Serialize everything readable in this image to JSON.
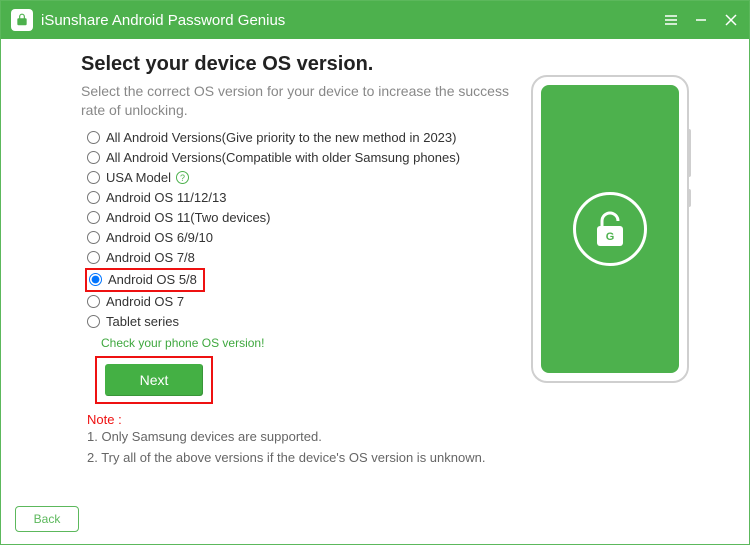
{
  "app": {
    "title": "iSunshare Android Password Genius"
  },
  "page": {
    "heading": "Select your device OS version.",
    "subheading": "Select the correct OS version for your device to increase the success rate of unlocking."
  },
  "options": [
    {
      "label": "All Android Versions(Give priority to the new method in 2023)",
      "selected": false,
      "help": false
    },
    {
      "label": "All Android Versions(Compatible with older Samsung phones)",
      "selected": false,
      "help": false
    },
    {
      "label": "USA Model",
      "selected": false,
      "help": true
    },
    {
      "label": "Android OS 11/12/13",
      "selected": false,
      "help": false
    },
    {
      "label": "Android OS 11(Two devices)",
      "selected": false,
      "help": false
    },
    {
      "label": "Android OS 6/9/10",
      "selected": false,
      "help": false
    },
    {
      "label": "Android OS 7/8",
      "selected": false,
      "help": false
    },
    {
      "label": "Android OS 5/8",
      "selected": true,
      "help": false
    },
    {
      "label": "Android OS 7",
      "selected": false,
      "help": false
    },
    {
      "label": "Tablet series",
      "selected": false,
      "help": false
    }
  ],
  "links": {
    "check_version": "Check your phone OS version!"
  },
  "buttons": {
    "next": "Next",
    "back": "Back"
  },
  "note": {
    "label": "Note :",
    "line1": "1. Only Samsung devices are supported.",
    "line2": "2. Try all of the above versions if the device's OS version is unknown."
  },
  "lock_letter": "G"
}
